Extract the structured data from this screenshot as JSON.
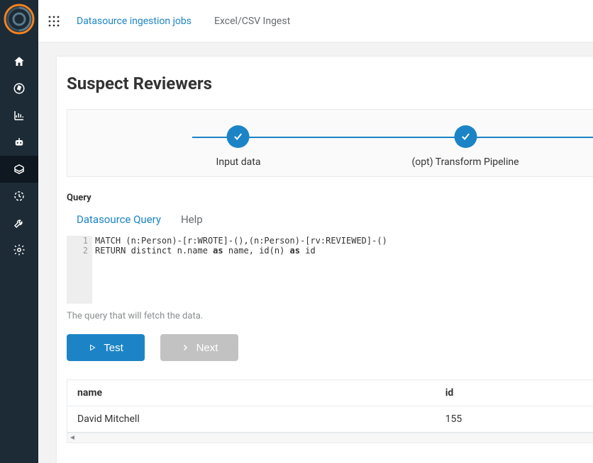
{
  "breadcrumb": {
    "parent": "Datasource ingestion jobs",
    "current": "Excel/CSV Ingest"
  },
  "page": {
    "title": "Suspect Reviewers"
  },
  "stepper": {
    "step1": "Input data",
    "step2": "(opt) Transform Pipeline"
  },
  "query": {
    "section_label": "Query",
    "tabs": {
      "datasource": "Datasource Query",
      "help": "Help"
    },
    "lines": {
      "l1_num": "1",
      "l2_num": "2",
      "l1a": "MATCH (n:Person)-[r:WROTE]-(),(n:Person)-[rv:REVIEWED]-()",
      "l2a": "RETURN distinct n.name ",
      "l2_kw1": "as",
      "l2b": " name, id(n) ",
      "l2_kw2": "as",
      "l2c": " id"
    },
    "helper": "The query that will fetch the data."
  },
  "buttons": {
    "test": "Test",
    "next": "Next"
  },
  "table": {
    "headers": {
      "name": "name",
      "id": "id"
    },
    "rows": [
      {
        "name": "David Mitchell",
        "id": "155"
      }
    ]
  }
}
